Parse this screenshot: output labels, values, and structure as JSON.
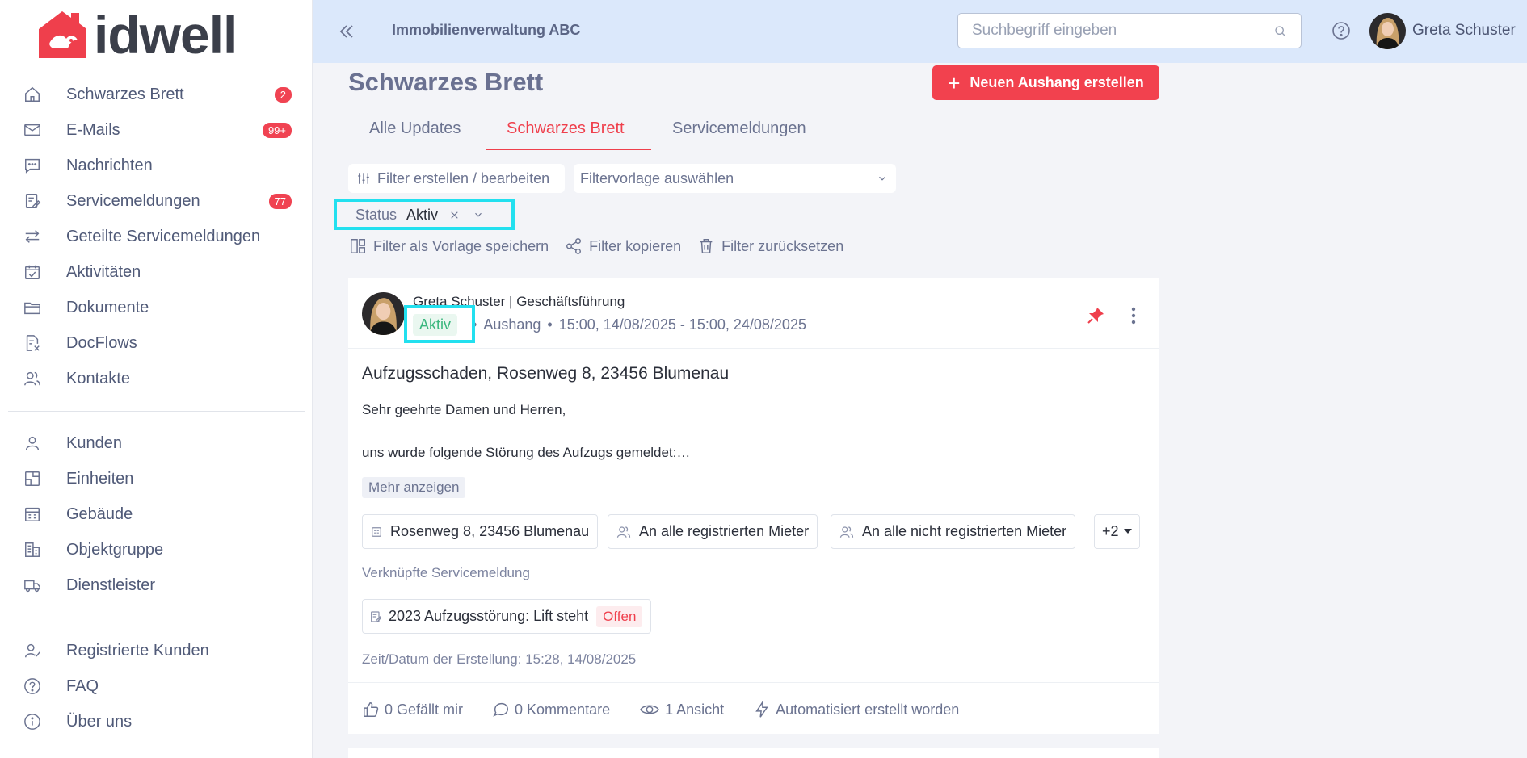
{
  "brand": {
    "name": "idwell",
    "accent": "#ef3f4c"
  },
  "sidebar": {
    "group1": [
      {
        "label": "Schwarzes Brett",
        "icon": "home-icon",
        "badge": "2"
      },
      {
        "label": "E-Mails",
        "icon": "mail-icon",
        "badge": "99+"
      },
      {
        "label": "Nachrichten",
        "icon": "chat-icon",
        "badge": ""
      },
      {
        "label": "Servicemeldungen",
        "icon": "service-report-icon",
        "badge": "77"
      },
      {
        "label": "Geteilte Servicemeldungen",
        "icon": "swap-arrows-icon",
        "badge": ""
      },
      {
        "label": "Aktivitäten",
        "icon": "calendar-check-icon",
        "badge": ""
      },
      {
        "label": "Dokumente",
        "icon": "folder-icon",
        "badge": ""
      },
      {
        "label": "DocFlows",
        "icon": "docflow-icon",
        "badge": ""
      },
      {
        "label": "Kontakte",
        "icon": "contacts-icon",
        "badge": ""
      }
    ],
    "group2": [
      {
        "label": "Kunden",
        "icon": "user-icon"
      },
      {
        "label": "Einheiten",
        "icon": "unit-icon"
      },
      {
        "label": "Gebäude",
        "icon": "building-icon"
      },
      {
        "label": "Objektgruppe",
        "icon": "object-group-icon"
      },
      {
        "label": "Dienstleister",
        "icon": "truck-icon"
      }
    ],
    "group3": [
      {
        "label": "Registrierte Kunden",
        "icon": "user-check-icon"
      },
      {
        "label": "FAQ",
        "icon": "question-icon"
      },
      {
        "label": "Über uns",
        "icon": "info-icon"
      }
    ]
  },
  "header": {
    "company": "Immobilienverwaltung ABC",
    "search_placeholder": "Suchbegriff eingeben",
    "user_name": "Greta Schuster"
  },
  "page": {
    "title": "Schwarzes Brett",
    "new_button": "Neuen Aushang erstellen",
    "tabs": [
      "Alle Updates",
      "Schwarzes Brett",
      "Servicemeldungen"
    ],
    "active_tab": "Schwarzes Brett"
  },
  "filters": {
    "edit_label": "Filter erstellen / bearbeiten",
    "template_placeholder": "Filtervorlage auswählen",
    "status_key": "Status",
    "status_value": "Aktiv",
    "save_template": "Filter als Vorlage speichern",
    "copy": "Filter kopieren",
    "reset": "Filter zurücksetzen"
  },
  "post": {
    "author": "Greta Schuster | Geschäftsführung",
    "status": "Aktiv",
    "type": "Aushang",
    "period": "15:00, 14/08/2025 - 15:00, 24/08/2025",
    "title": "Aufzugsschaden, Rosenweg 8, 23456 Blumenau",
    "body_line1": "Sehr geehrte Damen und Herren,",
    "body_line2": "uns wurde folgende Störung des Aufzugs gemeldet:…",
    "more": "Mehr anzeigen",
    "recipients": [
      {
        "label": "Rosenweg 8, 23456 Blumenau",
        "icon": "building-small-icon"
      },
      {
        "label": "An alle registrierten Mieter",
        "icon": "users-icon"
      },
      {
        "label": "An alle nicht registrierten Mieter",
        "icon": "users-icon"
      }
    ],
    "extra_count": "+2",
    "linked_label": "Verknüpfte Servicemeldung",
    "linked_item": "2023 Aufzugsstörung: Lift steht",
    "linked_status": "Offen",
    "created": "Zeit/Datum der Erstellung: 15:28, 14/08/2025",
    "likes": "0 Gefällt mir",
    "comments": "0 Kommentare",
    "views": "1 Ansicht",
    "automation": "Automatisiert erstellt worden"
  }
}
